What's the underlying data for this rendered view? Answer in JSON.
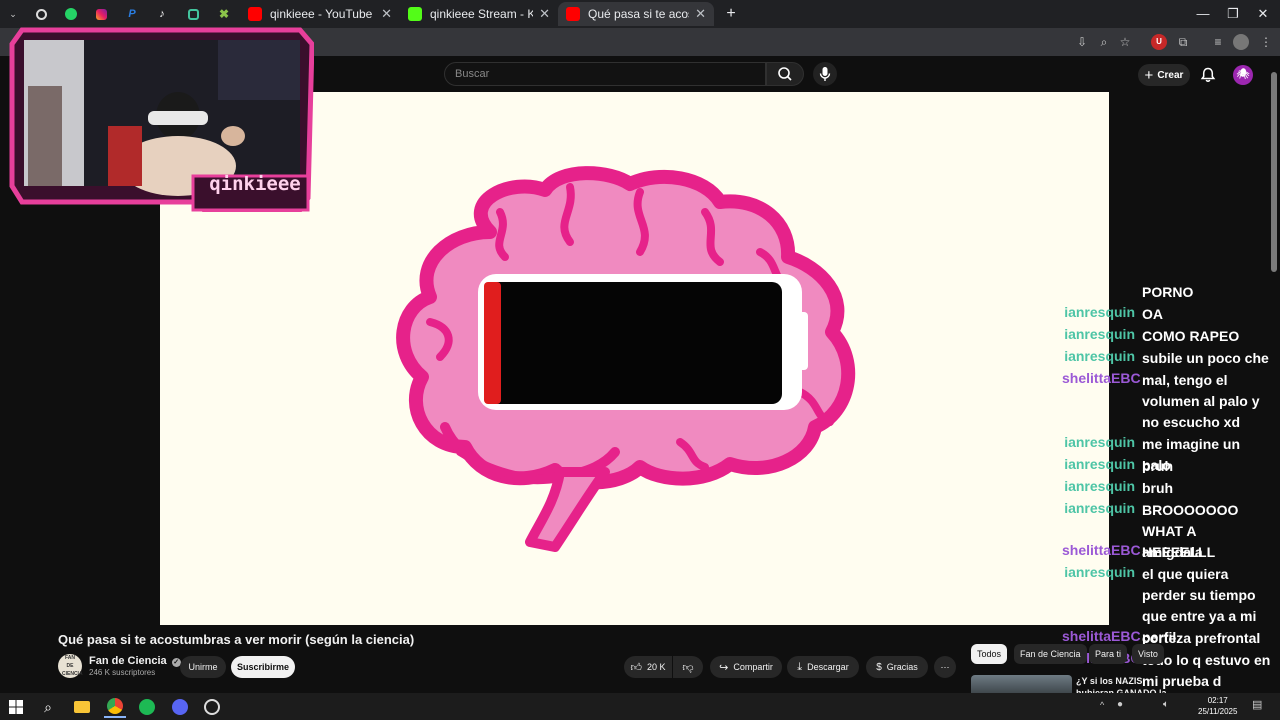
{
  "browser": {
    "tabs": [
      {
        "title": "qinkieee - YouTube",
        "color": "#ff0000"
      },
      {
        "title": "qinkieee Stream - Kick Dashboard",
        "color": "#53fc18"
      },
      {
        "title": "Qué pasa si te acostumbras a ver morir (según la ciencia)",
        "color": "#ff0000",
        "active": true
      }
    ],
    "new_tab": "+",
    "close_glyph": "✕"
  },
  "youtube": {
    "search_placeholder": "Buscar",
    "create_label": "Crear",
    "avatar_letter": "🕷"
  },
  "webcam": {
    "streamer_name": "qinkieee",
    "frame_color": "#e73f9b"
  },
  "video": {
    "title": "Qué pasa si te acostumbras a ver morir (según la ciencia)",
    "channel": "Fan de Ciencia",
    "channel_logo_text": "FAN DE CIENCIA",
    "subscribers": "246 K suscriptores",
    "join_label": "Unirme",
    "subscribe_label": "Suscribirme",
    "likes": "20 K",
    "share_label": "Compartir",
    "download_label": "Descargar",
    "thanks_label": "Gracias",
    "more_label": "⋯"
  },
  "recommendations": {
    "chips": [
      "Todos",
      "Fan de Ciencia",
      "Para ti",
      "Visto"
    ],
    "first_title": "¿Y si los NAZIS hubieran GANADO la GUERRA?"
  },
  "chat": {
    "colors": {
      "ianresquin": "#4ec5a6",
      "shelittaEBC": "#9b59d6"
    },
    "messages": [
      {
        "user": "",
        "text": "PORNO",
        "color": "#4ec5a6"
      },
      {
        "user": "ianresquin",
        "text": "OA",
        "color": "#4ec5a6"
      },
      {
        "user": "ianresquin",
        "text": "COMO RAPEO",
        "color": "#4ec5a6"
      },
      {
        "user": "ianresquin",
        "text": "subile un poco che",
        "color": "#4ec5a6"
      },
      {
        "user": "shelittaEBC",
        "text": "mal, tengo el volumen al palo y no escucho xd",
        "color": "#9b59d6"
      },
      {
        "user": "ianresquin",
        "text": "me imagine un palo",
        "color": "#4ec5a6"
      },
      {
        "user": "ianresquin",
        "text": "bruh",
        "color": "#4ec5a6"
      },
      {
        "user": "ianresquin",
        "text": "bruh",
        "color": "#4ec5a6"
      },
      {
        "user": "ianresquin",
        "text": "BROOOOOOO WHAT A HEEEELLL",
        "color": "#4ec5a6"
      },
      {
        "user": "shelittaEBC",
        "text": "amígdala",
        "color": "#9b59d6"
      },
      {
        "user": "ianresquin",
        "text": "el que quiera perder su tiempo que entre ya a mi perfil",
        "color": "#4ec5a6"
      },
      {
        "user": "shelittaEBC",
        "text": "corteza prefrontal",
        "color": "#9b59d6"
      },
      {
        "user": "shelittaEBC",
        "text": "todo lo q estuvo en mi prueba d psicología",
        "color": "#9b59d6"
      }
    ]
  },
  "taskbar": {
    "time": "02:17",
    "date": "25/11/2025"
  }
}
